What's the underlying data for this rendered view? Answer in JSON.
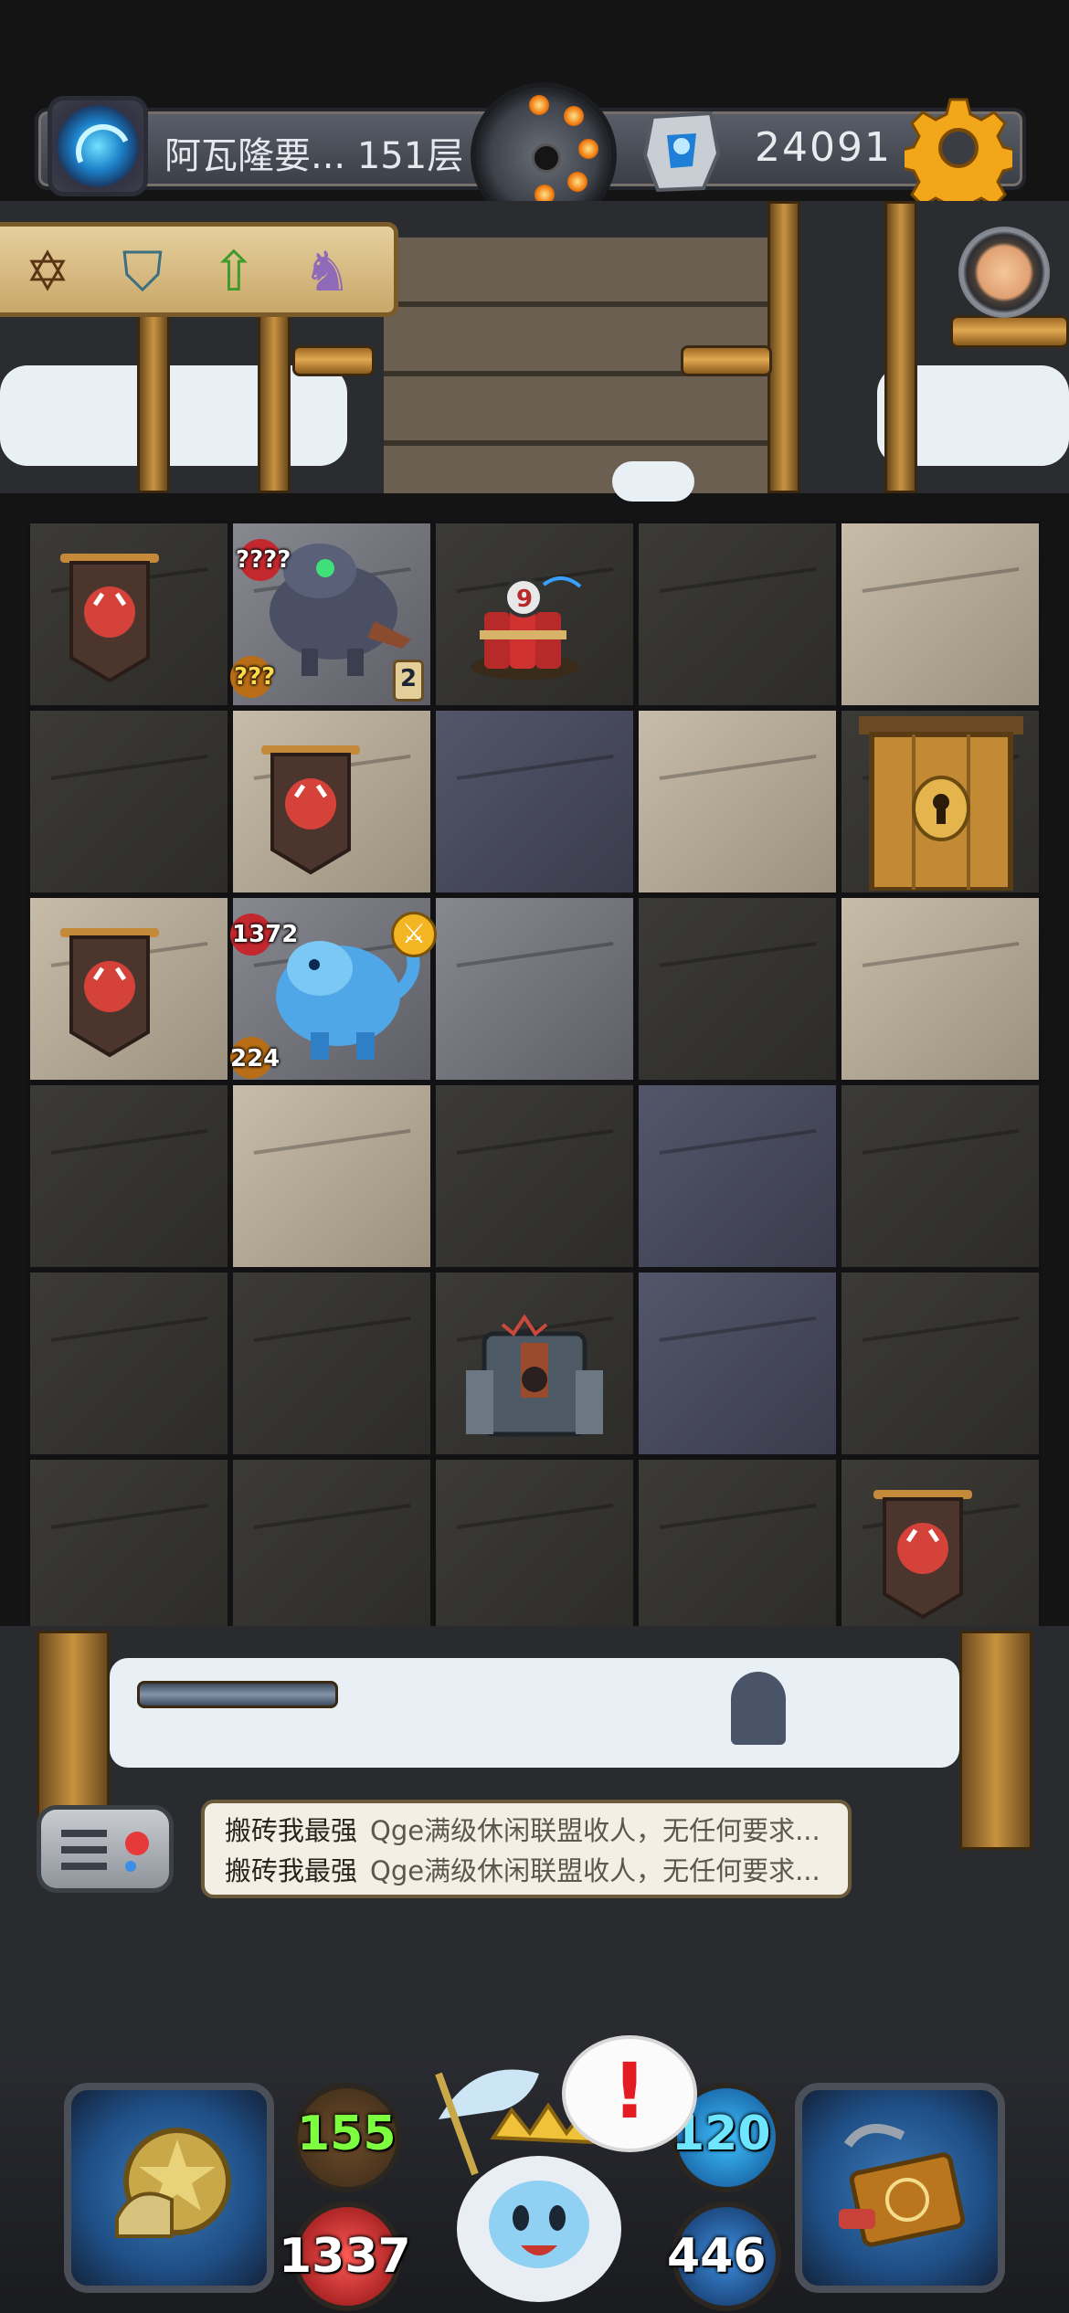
{
  "hud": {
    "floor_label": "阿瓦隆要... 151层",
    "score": "24091",
    "icons": [
      "portal-icon",
      "bomb-dial-icon",
      "gem-icon",
      "settings-gear-icon"
    ]
  },
  "buffs": [
    "hexagram-icon",
    "shield-icon",
    "arrow-up-icon",
    "winged-crest-icon"
  ],
  "board": {
    "monster_unknown": {
      "hp": "????",
      "attack": "???",
      "level": "2"
    },
    "monster_ice_beast": {
      "hp": "1372",
      "attack": "224"
    },
    "items": [
      "enemy-banner-icon",
      "dynamite-bundle-icon",
      "locked-door-icon",
      "altar-machine-icon"
    ]
  },
  "chat": {
    "lines": [
      {
        "sender": "搬砖我最强",
        "message": "Qge满级休闲联盟收人，无任何要求..."
      },
      {
        "sender": "搬砖我最强",
        "message": "Qge满级休闲联盟收人，无任何要求..."
      }
    ]
  },
  "player": {
    "attack": "155",
    "defense": "120",
    "hp": "1337",
    "mana": "446",
    "alert": "!"
  },
  "colors": {
    "attack": "#7dff3f",
    "defense": "#6fe6ff",
    "hp": "#ffffff",
    "mana": "#ffffff",
    "alert": "#e31b23"
  }
}
